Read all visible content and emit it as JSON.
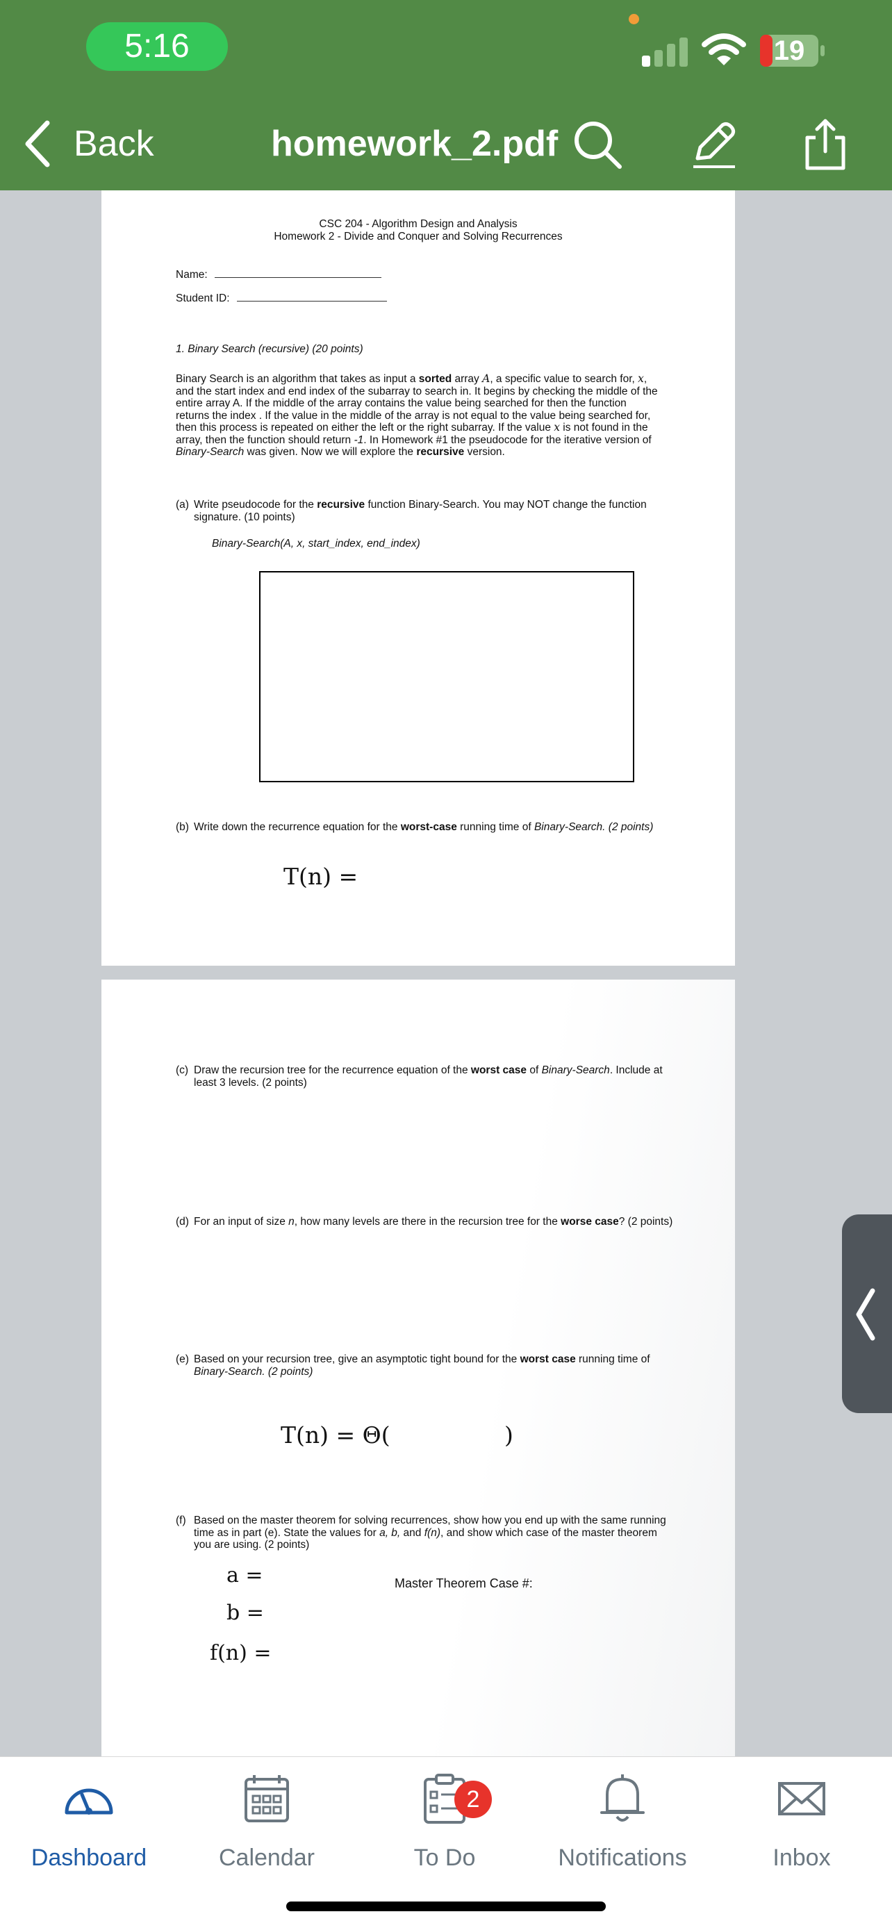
{
  "status_bar": {
    "time": "5:16",
    "battery": "19",
    "colors": {
      "bar": "#528a46",
      "time_pill": "#35c759",
      "battery_low": "#e7332b",
      "orange_dot": "#f29c38"
    }
  },
  "nav": {
    "back_label": "Back",
    "title": "homework_2.pdf",
    "actions": [
      "search-icon",
      "markup-pen-icon",
      "share-icon"
    ]
  },
  "document": {
    "header_line1": "CSC 204 - Algorithm Design and Analysis",
    "header_line2": "Homework 2 - Divide and Conquer and Solving Recurrences",
    "name_label": "Name:",
    "student_id_label": "Student ID:",
    "q1_title": "1.  Binary Search (recursive) (20 points)",
    "q1_intro": [
      "Binary Search is an algorithm that takes as input a ",
      "sorted",
      " array ",
      "A",
      ", a specific value to search for, ",
      "x",
      ", and the start index and end index of the subarray to search in. It begins by checking the middle of the entire array A. If the middle of the array contains the value being searched for then the function returns the index . If the value in the middle of the array is not equal to the value being searched for, then this process is repeated on either the left or the right subarray. If the value ",
      "x",
      " is not found in the array, then the function should return ",
      "-1",
      ". In Homework #1 the pseudocode for the iterative version of ",
      "Binary-Search",
      " was given. Now we will explore the ",
      "recursive",
      " version."
    ],
    "qa": {
      "label": "(a)",
      "text": [
        "Write pseudocode for the ",
        "recursive",
        " function Binary-Search. You may NOT change the function signature. (10 points)"
      ],
      "signature": "Binary-Search(A, x, start_index, end_index)"
    },
    "qb": {
      "label": "(b)",
      "text": [
        "Write down the recurrence equation for the ",
        "worst-case",
        " running time of ",
        "Binary-Search. (2 points)"
      ],
      "math": "T(n) ="
    },
    "qc": {
      "label": "(c)",
      "text": [
        "Draw the recursion tree for the recurrence equation of the ",
        "worst case",
        " of ",
        "Binary-Search",
        ". Include at least 3 levels. (2 points)"
      ]
    },
    "qd": {
      "label": "(d)",
      "text": [
        "For an input of size ",
        "n",
        ", how many levels are there in the recursion tree for the ",
        "worse case",
        "? (2 points)"
      ]
    },
    "qe": {
      "label": "(e)",
      "text": [
        "Based on your recursion tree, give an asymptotic tight bound for the ",
        "worst case",
        " running time of ",
        "Binary-Search. (2 points)"
      ],
      "math_left": "T(n) = Θ(",
      "math_right": ")"
    },
    "qf": {
      "label": "(f)",
      "text": [
        "Based on the master theorem for solving recurrences, show how you end up with the same running time as in part (e). State the values for ",
        "a, b,",
        " and ",
        "f(n)",
        ", and show which case of the master theorem you are using. (2 points)"
      ],
      "a": "a =",
      "b": "b =",
      "fn": "f(n) =",
      "case_label": "Master Theorem Case #:"
    }
  },
  "tabbar": {
    "items": [
      {
        "label": "Dashboard",
        "icon": "dashboard-gauge-icon",
        "active": true
      },
      {
        "label": "Calendar",
        "icon": "calendar-icon",
        "active": false
      },
      {
        "label": "To Do",
        "icon": "todo-clipboard-icon",
        "active": false,
        "badge": "2"
      },
      {
        "label": "Notifications",
        "icon": "bell-icon",
        "active": false
      },
      {
        "label": "Inbox",
        "icon": "mail-icon",
        "active": false
      }
    ],
    "colors": {
      "active": "#1f5ca6",
      "inactive": "#6b7780",
      "badge": "#e7332b"
    }
  }
}
